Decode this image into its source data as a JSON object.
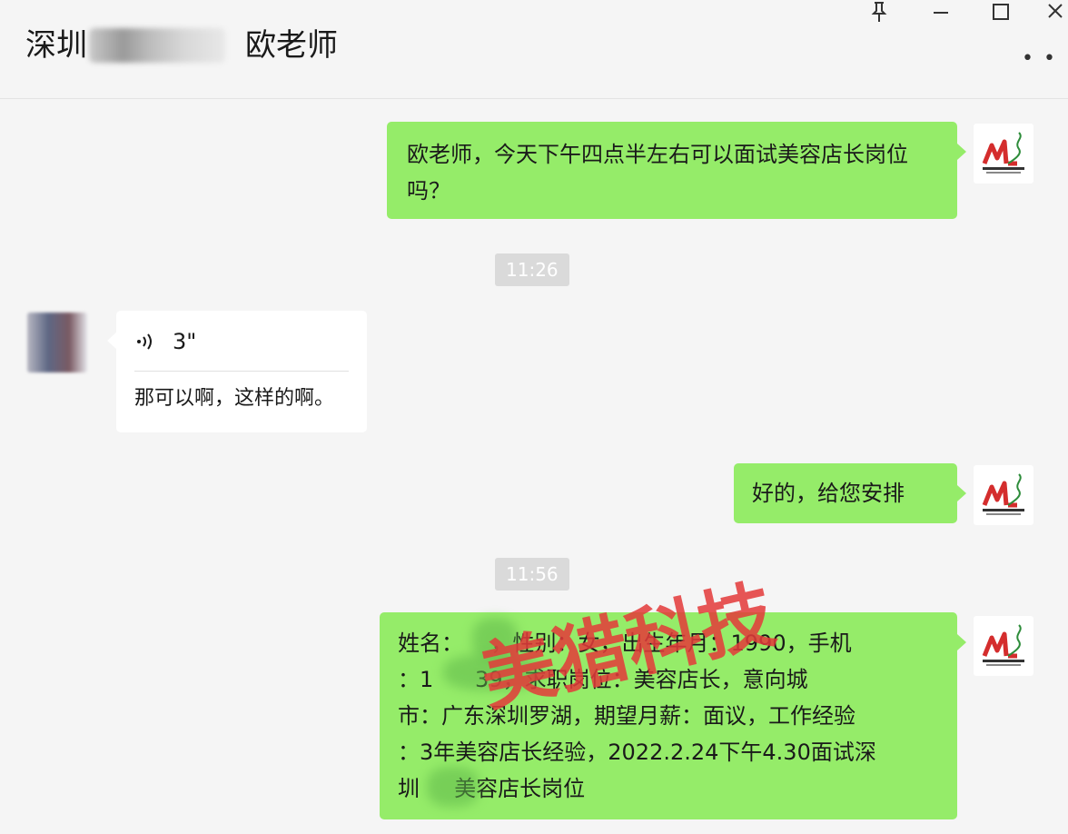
{
  "header": {
    "title_prefix": "深圳",
    "title_suffix": "欧老师",
    "pin_icon": "pin-icon",
    "minimize_icon": "minimize-icon",
    "maximize_icon": "maximize-icon",
    "close_icon": "close-icon",
    "more_icon": "more-icon"
  },
  "messages": [
    {
      "side": "right",
      "text": "欧老师，今天下午四点半左右可以面试美容店长岗位吗？"
    },
    {
      "type": "time",
      "text": "11:26"
    },
    {
      "side": "left",
      "voice_duration": "3\"",
      "text": "那可以啊，这样的啊。"
    },
    {
      "side": "right",
      "text": "好的，给您安排"
    },
    {
      "type": "time",
      "text": "11:56"
    },
    {
      "side": "right",
      "lines": [
        "姓名：    ，性别：女，出生年月：1990，手机",
        "：1      39，求职岗位：美容店长，意向城",
        "市：广东深圳罗湖，期望月薪：面议，工作经验",
        "：3年美容店长经验，2022.2.24下午4.30面试深",
        "圳     美容店长岗位"
      ]
    }
  ],
  "watermark": "美猎科技",
  "colors": {
    "bubble_self": "#95ec69",
    "bubble_other": "#ffffff",
    "background": "#f5f5f5",
    "watermark": "#e43a3a"
  }
}
